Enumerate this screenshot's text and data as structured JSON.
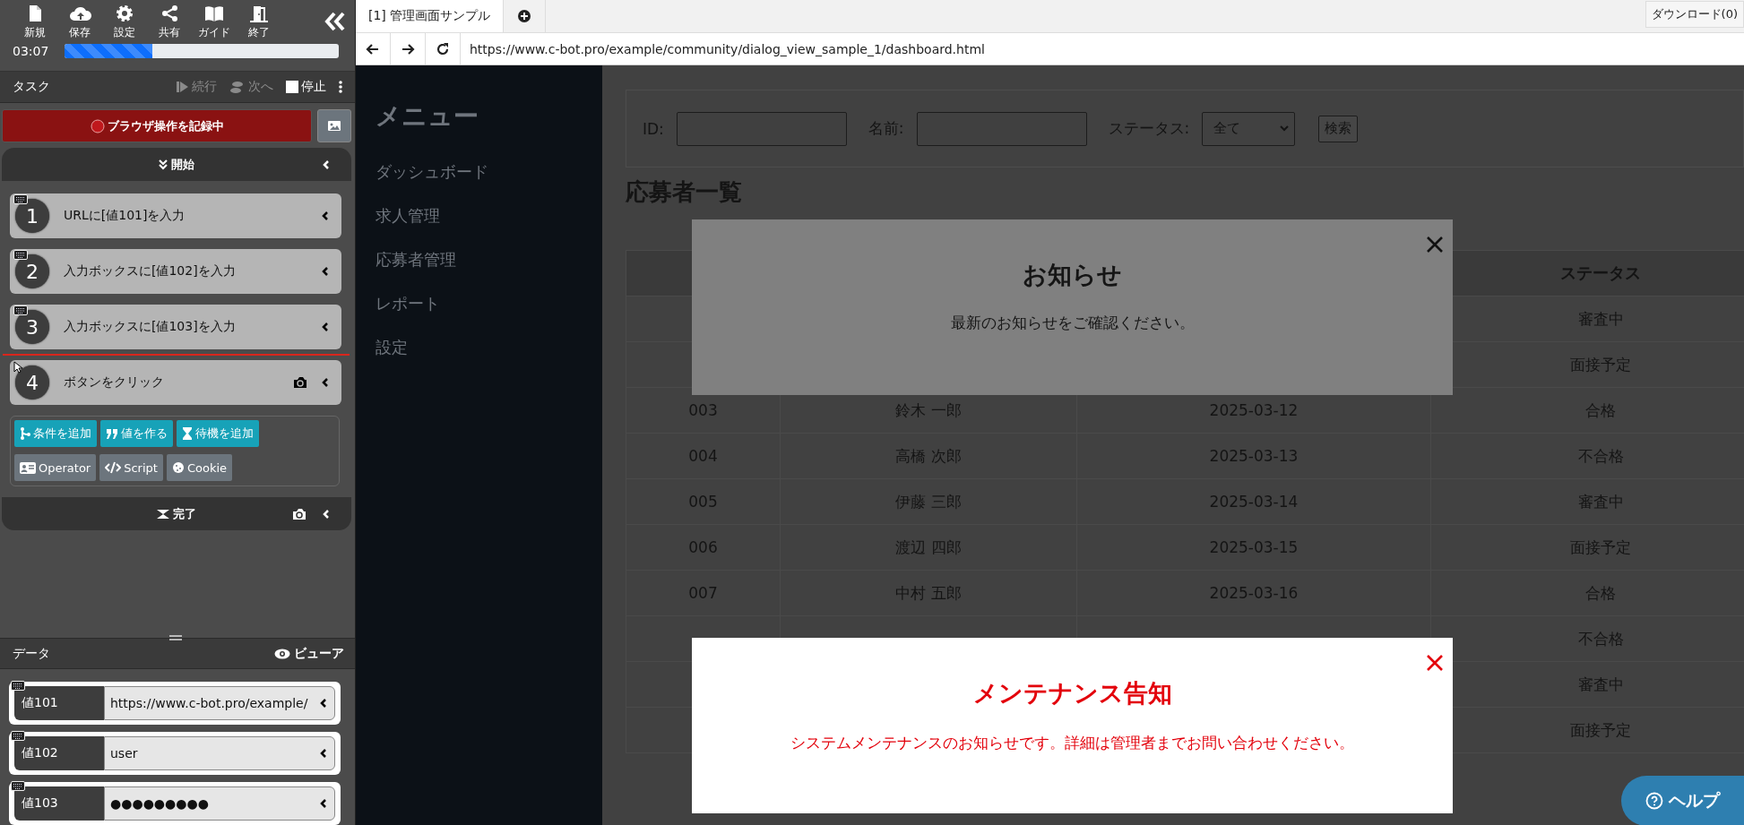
{
  "tool_panel": {
    "toolbar": [
      {
        "label": "新規"
      },
      {
        "label": "保存"
      },
      {
        "label": "設定"
      },
      {
        "label": "共有"
      },
      {
        "label": "ガイド"
      },
      {
        "label": "終了"
      }
    ],
    "timer": "03:07",
    "progress": {
      "level": 0.32
    },
    "task_header": {
      "title": "タスク",
      "actions": [
        {
          "label": "続行",
          "kind": "play",
          "disabled": true
        },
        {
          "label": "次へ",
          "kind": "steps",
          "disabled": true
        },
        {
          "label": "停止",
          "kind": "checkbox",
          "checked": false
        }
      ]
    },
    "record_button": "ブラウザ操作を記録中",
    "start_block": "開始",
    "steps": [
      {
        "number": "1",
        "label": "URLに[値101]を入力",
        "kind": "keyboard",
        "screenshot": false,
        "insert_here": false
      },
      {
        "number": "2",
        "label": "入力ボックスに[値102]を入力",
        "kind": "keyboard",
        "screenshot": false,
        "insert_here": false
      },
      {
        "number": "3",
        "label": "入力ボックスに[値103]を入力",
        "kind": "keyboard",
        "screenshot": false,
        "insert_here": false
      },
      {
        "number": "4",
        "label": "ボタンをクリック",
        "kind": "click",
        "screenshot": true,
        "insert_here": true
      }
    ],
    "add_buttons": [
      {
        "label": "条件を追加",
        "kind": "primary"
      },
      {
        "label": "値を作る",
        "kind": "primary"
      },
      {
        "label": "待機を追加",
        "kind": "primary"
      },
      {
        "label": "Operator",
        "kind": "secondary"
      },
      {
        "label": "Script",
        "kind": "secondary"
      },
      {
        "label": "Cookie",
        "kind": "secondary"
      }
    ],
    "end_block": {
      "label": "完了",
      "screenshot": true
    },
    "data_panel": {
      "title": "データ",
      "viewer": "ビューア",
      "items": [
        {
          "name": "値101",
          "value": "https://www.c-bot.pro/example/"
        },
        {
          "name": "値102",
          "value": "user"
        },
        {
          "name": "値103",
          "value": "●●●●●●●●●"
        }
      ]
    }
  },
  "browser": {
    "tabs": [
      {
        "label": "[1] 管理画面サンプル",
        "selected": true
      }
    ],
    "download": "ダウンロード(0)",
    "url": "https://www.c-bot.pro/example/community/dialog_view_sample_1/dashboard.html",
    "page": {
      "sidebar": {
        "title": "メニュー",
        "items": [
          "ダッシュボード",
          "求人管理",
          "応募者管理",
          "レポート",
          "設定"
        ]
      },
      "search": {
        "id_label": "ID:",
        "name_label": "名前:",
        "status_label": "ステータス:",
        "status_value": "全て",
        "button": "検索"
      },
      "heading": "応募者一覧",
      "table": {
        "columns": [
          "",
          "",
          "",
          "ステータス"
        ],
        "rows": [
          [
            "",
            "",
            "",
            "審査中"
          ],
          [
            "",
            "",
            "",
            "面接予定"
          ],
          [
            "003",
            "鈴木 一郎",
            "2025-03-12",
            "合格"
          ],
          [
            "004",
            "高橋 次郎",
            "2025-03-13",
            "不合格"
          ],
          [
            "005",
            "伊藤 三郎",
            "2025-03-14",
            "審査中"
          ],
          [
            "006",
            "渡辺 四郎",
            "2025-03-15",
            "面接予定"
          ],
          [
            "007",
            "中村 五郎",
            "2025-03-16",
            "合格"
          ],
          [
            "",
            "",
            "",
            "不合格"
          ],
          [
            "",
            "",
            "",
            "審査中"
          ],
          [
            "",
            "",
            "",
            "面接予定"
          ]
        ]
      },
      "dialogs": [
        {
          "kind": "dimmed",
          "title": "お知らせ",
          "message": "最新のお知らせをご確認ください。"
        },
        {
          "kind": "alert",
          "title": "メンテナンス告知",
          "message": "システムメンテナンスのお知らせです。詳細は管理者までお問い合わせください。"
        }
      ],
      "help": "ヘルプ"
    }
  }
}
